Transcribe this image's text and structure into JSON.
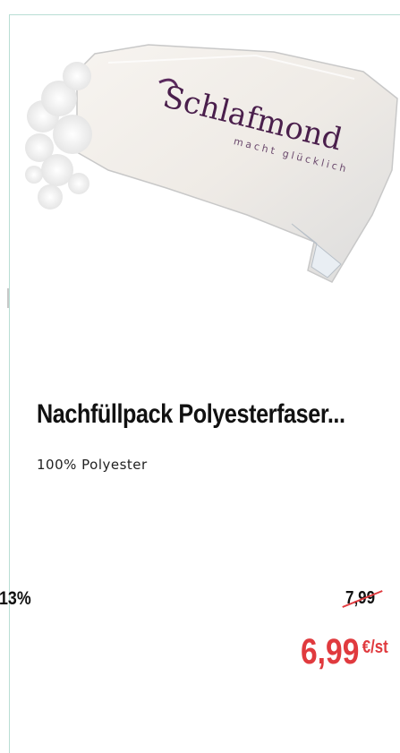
{
  "product": {
    "brand_logo_text": "Schlafmond",
    "brand_slogan": "macht glücklich",
    "image_icon": "refill-pack-image",
    "title": "Nachfüllpack Polyesterfaser...",
    "description": "100% Polyester",
    "discount": "13%",
    "old_price": "7,99",
    "price": "6,99",
    "price_unit": "€/st"
  },
  "colors": {
    "price_red": "#e03a3e",
    "card_border": "#b9ded4",
    "text_dark": "#111111"
  }
}
